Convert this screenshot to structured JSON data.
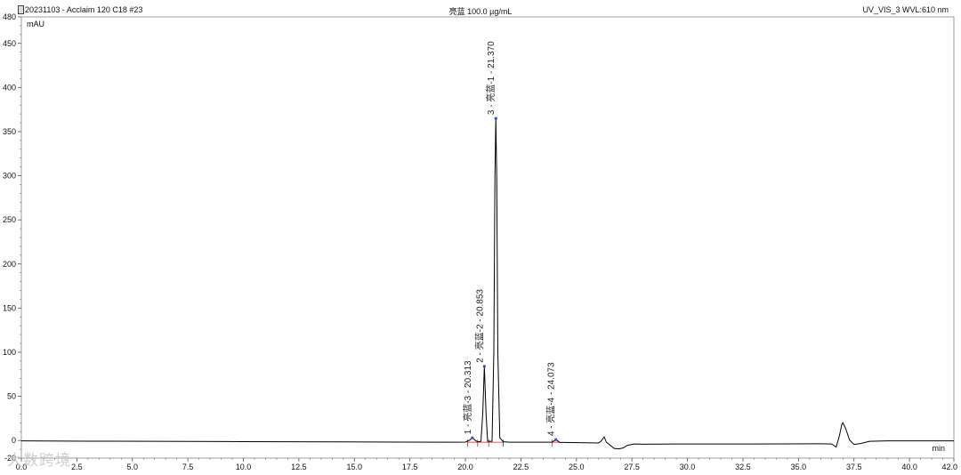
{
  "header": {
    "file_title": "20231103 - Acclaim 120 C18 #23",
    "sample_title": "亮蓝 100.0 µg/mL",
    "detector": "UV_VIS_3 WVL:610 nm"
  },
  "watermark": "大数跨境",
  "chart_data": {
    "type": "line",
    "ylabel": "mAU",
    "xlabel": "min",
    "xlim": [
      0,
      42
    ],
    "ylim": [
      -20,
      480
    ],
    "x_ticks": [
      "0.0",
      "2.5",
      "5.0",
      "7.5",
      "10.0",
      "12.5",
      "15.0",
      "17.5",
      "20.0",
      "22.5",
      "25.0",
      "27.5",
      "30.0",
      "32.5",
      "35.0",
      "37.5",
      "40.0",
      "42.0"
    ],
    "x_tick_values": [
      0,
      2.5,
      5,
      7.5,
      10,
      12.5,
      15,
      17.5,
      20,
      22.5,
      25,
      27.5,
      30,
      32.5,
      35,
      37.5,
      40,
      42
    ],
    "y_ticks": [
      "-20",
      "0",
      "50",
      "100",
      "150",
      "200",
      "250",
      "300",
      "350",
      "400",
      "450",
      "480"
    ],
    "y_tick_values": [
      -20,
      0,
      50,
      100,
      150,
      200,
      250,
      300,
      350,
      400,
      450,
      480
    ],
    "peaks": [
      {
        "number": 1,
        "label": "1 - 亮蓝-3 - 20.313",
        "rt": 20.313,
        "height": 3
      },
      {
        "number": 2,
        "label": "2 - 亮蓝-2 - 20.853",
        "rt": 20.853,
        "height": 84
      },
      {
        "number": 3,
        "label": "3 - 亮蓝-1 - 21.370",
        "rt": 21.37,
        "height": 365
      },
      {
        "number": 4,
        "label": "4 - 亮蓝-4 - 24.073",
        "rt": 24.073,
        "height": 1
      }
    ],
    "series": [
      {
        "color": "#000000",
        "points": [
          [
            0.0,
            -0.5
          ],
          [
            3.0,
            -0.8
          ],
          [
            6.0,
            -1.0
          ],
          [
            10.0,
            -1.3
          ],
          [
            14.0,
            -1.6
          ],
          [
            17.0,
            -1.8
          ],
          [
            19.5,
            -2.0
          ],
          [
            20.0,
            -1.8
          ],
          [
            20.2,
            0.5
          ],
          [
            20.31,
            3.0
          ],
          [
            20.42,
            0.6
          ],
          [
            20.55,
            -1.6
          ],
          [
            20.7,
            -1.0
          ],
          [
            20.78,
            30.0
          ],
          [
            20.853,
            84.0
          ],
          [
            20.93,
            30.0
          ],
          [
            21.0,
            -1.0
          ],
          [
            21.2,
            -1.0
          ],
          [
            21.28,
            100.0
          ],
          [
            21.33,
            300.0
          ],
          [
            21.37,
            365.0
          ],
          [
            21.41,
            300.0
          ],
          [
            21.46,
            100.0
          ],
          [
            21.55,
            3.0
          ],
          [
            21.7,
            -1.5
          ],
          [
            22.0,
            -2.0
          ],
          [
            23.9,
            -2.0
          ],
          [
            24.07,
            1.0
          ],
          [
            24.25,
            -2.2
          ],
          [
            26.0,
            -2.8
          ],
          [
            26.1,
            -1.0
          ],
          [
            26.25,
            4.0
          ],
          [
            26.35,
            -2.0
          ],
          [
            26.7,
            -9.0
          ],
          [
            26.9,
            -9.5
          ],
          [
            27.1,
            -8.5
          ],
          [
            27.3,
            -5.5
          ],
          [
            27.6,
            -4.0
          ],
          [
            28.0,
            -4.2
          ],
          [
            30.0,
            -4.0
          ],
          [
            33.0,
            -4.0
          ],
          [
            36.0,
            -3.8
          ],
          [
            36.5,
            -4.0
          ],
          [
            36.7,
            -7.5
          ],
          [
            36.85,
            6.0
          ],
          [
            36.95,
            18.0
          ],
          [
            37.0,
            20.0
          ],
          [
            37.12,
            14.0
          ],
          [
            37.3,
            0.5
          ],
          [
            37.5,
            -4.5
          ],
          [
            37.8,
            -3.5
          ],
          [
            38.2,
            -1.0
          ],
          [
            39.0,
            -0.5
          ],
          [
            40.0,
            -0.5
          ],
          [
            42.0,
            -0.5
          ]
        ]
      }
    ]
  }
}
